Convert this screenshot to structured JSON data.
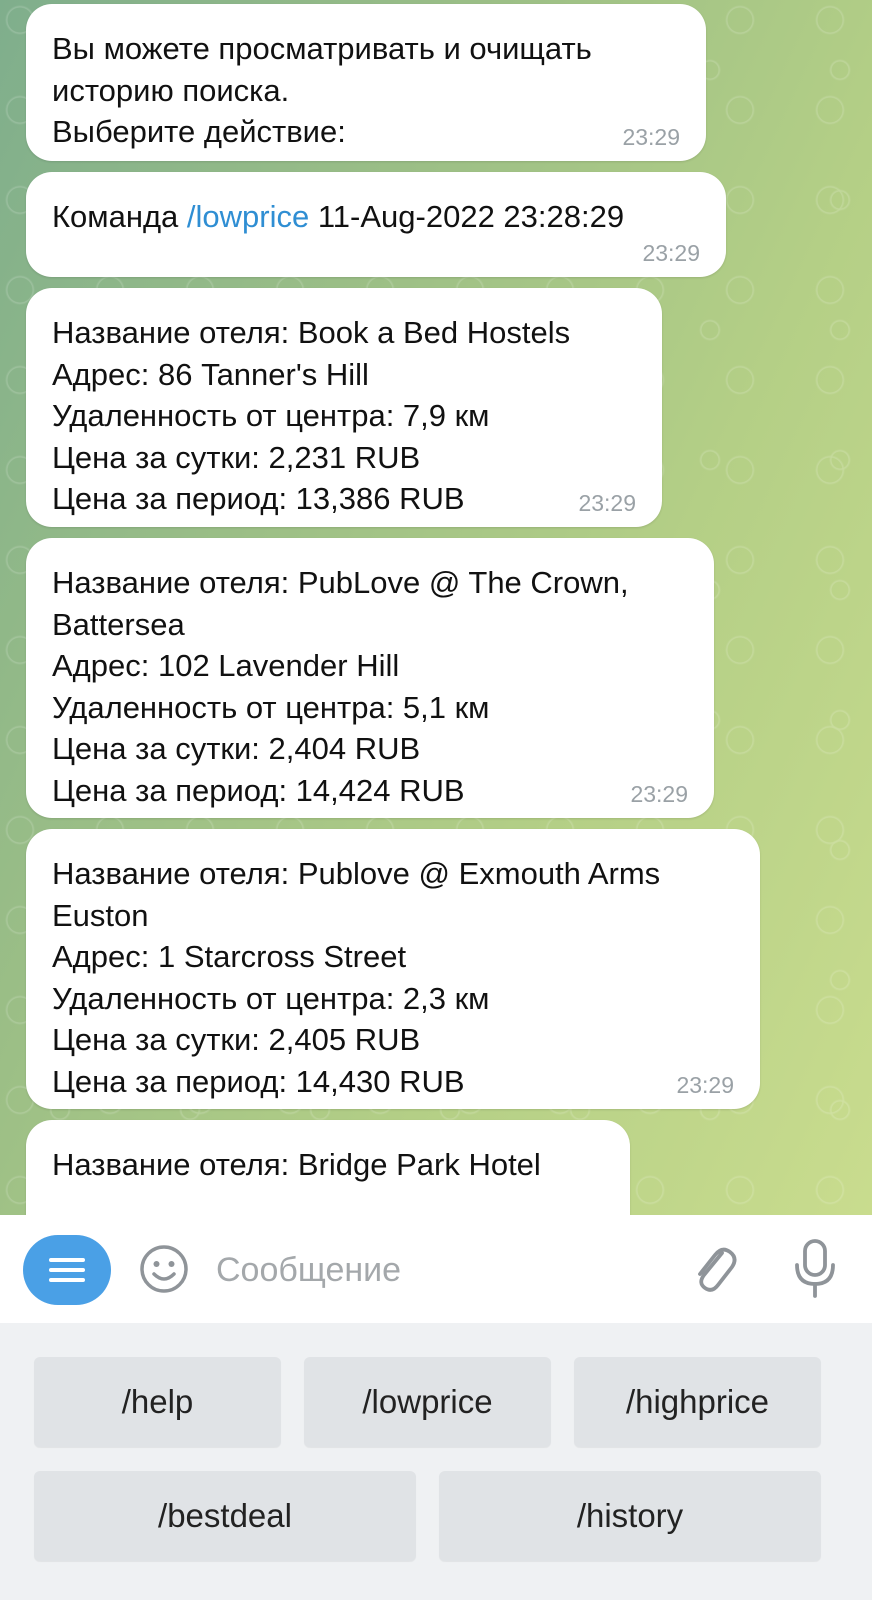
{
  "messages": {
    "m1": {
      "lines": "Вы можете просматривать и очищать\nисторию поиска.\nВыберите действие:",
      "time": "23:29"
    },
    "m2": {
      "prefix": "Команда ",
      "command": "/lowprice",
      "suffix": " 11-Aug-2022 23:28:29",
      "time": "23:29"
    },
    "m3": {
      "lines": "Название отеля: Book a Bed Hostels\nАдрес: 86 Tanner's Hill\nУдаленность от центра: 7,9 км\nЦена за сутки: 2,231 RUB\nЦена за период: 13,386 RUB",
      "time": "23:29"
    },
    "m4": {
      "lines": "Название отеля: PubLove @ The Crown,\nBattersea\nАдрес: 102 Lavender Hill\nУдаленность от центра: 5,1 км\nЦена за сутки: 2,404 RUB\nЦена за период: 14,424 RUB",
      "time": "23:29"
    },
    "m5": {
      "lines": "Название отеля: Publove @ Exmouth Arms\nEuston\nАдрес: 1 Starcross Street\nУдаленность от центра: 2,3 км\nЦена за сутки: 2,405 RUB\nЦена за период: 14,430 RUB",
      "time": "23:29"
    },
    "m6": {
      "lines": "Название отеля: Bridge Park Hotel"
    }
  },
  "composer": {
    "placeholder": "Сообщение",
    "menu_icon": "menu-icon",
    "emoji_icon": "smiley-icon",
    "attach_icon": "paperclip-icon",
    "mic_icon": "microphone-icon",
    "accent": "#4aa0e6"
  },
  "keyboard": {
    "help": "/help",
    "lowprice": "/lowprice",
    "highprice": "/highprice",
    "bestdeal": "/bestdeal",
    "history": "/history"
  }
}
